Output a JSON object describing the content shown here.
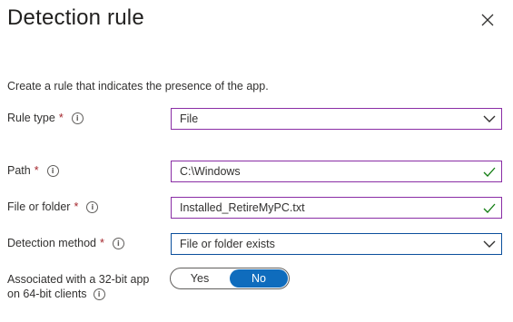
{
  "panel": {
    "title": "Detection rule",
    "description": "Create a rule that indicates the presence of the app."
  },
  "fields": {
    "rule_type": {
      "label": "Rule type",
      "required_mark": "*",
      "info": "i",
      "value": "File"
    },
    "path": {
      "label": "Path",
      "required_mark": "*",
      "info": "i",
      "value": "C:\\Windows"
    },
    "file_or_folder": {
      "label": "File or folder",
      "required_mark": "*",
      "info": "i",
      "value": "Installed_RetireMyPC.txt"
    },
    "detection_method": {
      "label": "Detection method",
      "required_mark": "*",
      "info": "i",
      "value": "File or folder exists"
    }
  },
  "toggle": {
    "label_line1": "Associated with a 32-bit app",
    "label_line2": "on 64-bit clients",
    "info": "i",
    "options": [
      "Yes",
      "No"
    ],
    "selected": "No"
  },
  "colors": {
    "border_default": "#8a2da5",
    "border_focused": "#0b4f9c",
    "valid_check": "#107c10",
    "required": "#a4262c",
    "toggle_selected": "#0f6cbd"
  },
  "icons": {
    "close": "close-icon",
    "dropdown": "chevron-down-icon",
    "valid": "checkmark-icon",
    "info": "info-icon"
  }
}
